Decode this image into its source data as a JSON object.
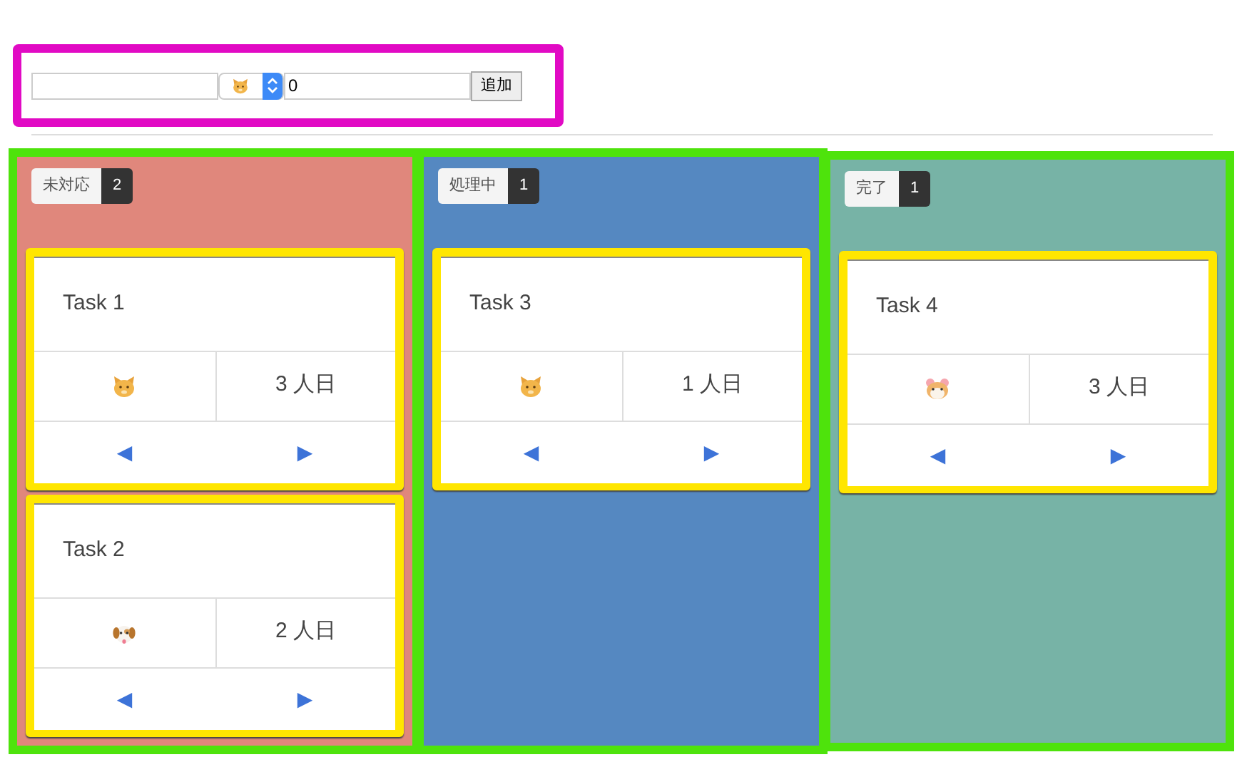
{
  "form": {
    "assignee": {
      "kind": "cat"
    },
    "days_value": "0",
    "add_button": "追加"
  },
  "columns": [
    {
      "label": "未対応",
      "count": "2",
      "color": "#e0877c",
      "tasks": [
        {
          "title": "Task 1",
          "kind": "cat",
          "days": "3 人日",
          "prev": "◀",
          "next": "▶"
        },
        {
          "title": "Task 2",
          "kind": "dog",
          "days": "2 人日",
          "prev": "◀",
          "next": "▶"
        }
      ]
    },
    {
      "label": "処理中",
      "count": "1",
      "color": "#5588c1",
      "tasks": [
        {
          "title": "Task 3",
          "kind": "cat",
          "days": "1 人日",
          "prev": "◀",
          "next": "▶"
        }
      ]
    },
    {
      "label": "完了",
      "count": "1",
      "color": "#77b3a6",
      "tasks": [
        {
          "title": "Task 4",
          "kind": "hamster",
          "days": "3 人日",
          "prev": "◀",
          "next": "▶"
        }
      ]
    }
  ]
}
